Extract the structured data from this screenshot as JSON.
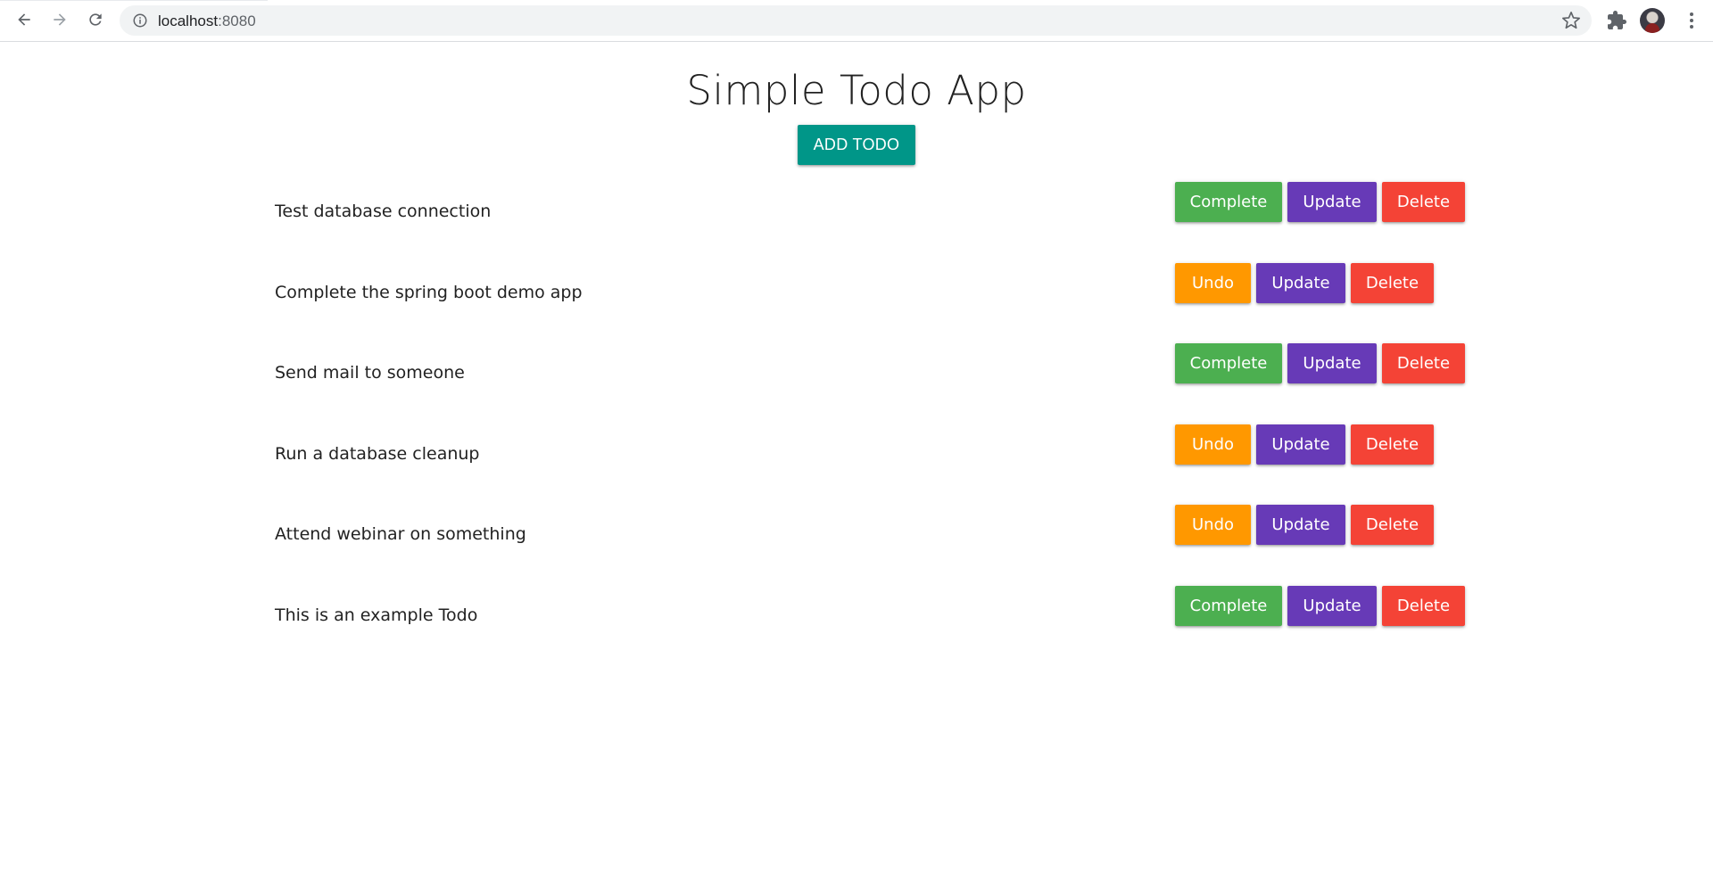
{
  "browser": {
    "url_host": "localhost",
    "url_port": ":8080"
  },
  "page": {
    "title": "Simple Todo App",
    "add_button_label": "ADD TODO"
  },
  "todos": [
    {
      "text": "Test database connection",
      "completed": false,
      "toggle_label": "Complete",
      "update_label": "Update",
      "delete_label": "Delete"
    },
    {
      "text": "Complete the spring boot demo app",
      "completed": true,
      "toggle_label": "Undo",
      "update_label": "Update",
      "delete_label": "Delete"
    },
    {
      "text": "Send mail to someone",
      "completed": false,
      "toggle_label": "Complete",
      "update_label": "Update",
      "delete_label": "Delete"
    },
    {
      "text": "Run a database cleanup",
      "completed": true,
      "toggle_label": "Undo",
      "update_label": "Update",
      "delete_label": "Delete"
    },
    {
      "text": "Attend webinar on something",
      "completed": true,
      "toggle_label": "Undo",
      "update_label": "Update",
      "delete_label": "Delete"
    },
    {
      "text": "This is an example Todo",
      "completed": false,
      "toggle_label": "Complete",
      "update_label": "Update",
      "delete_label": "Delete"
    }
  ],
  "colors": {
    "add": "#009688",
    "complete": "#4caf50",
    "undo": "#ff9800",
    "update": "#673ab7",
    "delete": "#f44336"
  },
  "icons": {
    "back": "back-arrow-icon",
    "forward": "forward-arrow-icon",
    "reload": "reload-icon",
    "info": "info-icon",
    "bookmark": "star-icon",
    "extensions": "puzzle-icon",
    "profile": "avatar",
    "menu": "kebab-menu-icon"
  }
}
